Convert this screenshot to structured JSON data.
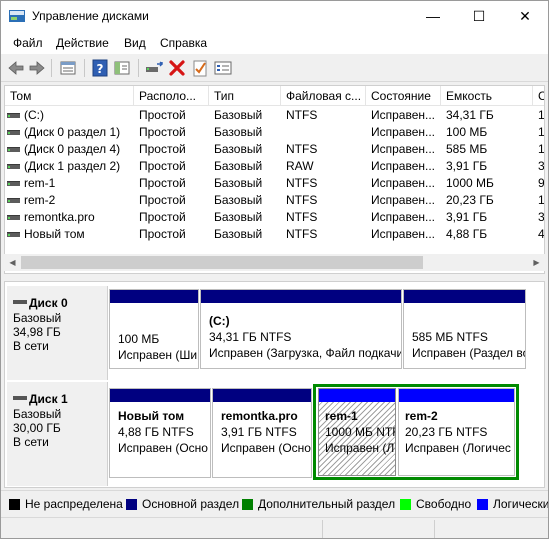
{
  "window": {
    "title": "Управление дисками",
    "controls": {
      "minimize": "—",
      "maximize": "☐",
      "close": "✕"
    }
  },
  "menu": [
    "Файл",
    "Действие",
    "Вид",
    "Справка"
  ],
  "toolbar": {
    "icons": [
      "back-arrow-icon",
      "forward-arrow-icon",
      "properties-list-icon",
      "help-icon",
      "show-hide-pane-icon",
      "connect-disk-icon",
      "delete-icon",
      "check-mark-icon",
      "settings-panel-icon"
    ]
  },
  "volume_list": {
    "columns": [
      "Том",
      "Располо...",
      "Тип",
      "Файловая с...",
      "Состояние",
      "Емкость",
      "С"
    ],
    "rows": [
      {
        "name": "(C:)",
        "layout": "Простой",
        "type": "Базовый",
        "fs": "NTFS",
        "status": "Исправен...",
        "capacity": "34,31 ГБ",
        "free": "1"
      },
      {
        "name": "(Диск 0 раздел 1)",
        "layout": "Простой",
        "type": "Базовый",
        "fs": "",
        "status": "Исправен...",
        "capacity": "100 МБ",
        "free": "1"
      },
      {
        "name": "(Диск 0 раздел 4)",
        "layout": "Простой",
        "type": "Базовый",
        "fs": "NTFS",
        "status": "Исправен...",
        "capacity": "585 МБ",
        "free": "1"
      },
      {
        "name": "(Диск 1 раздел 2)",
        "layout": "Простой",
        "type": "Базовый",
        "fs": "RAW",
        "status": "Исправен...",
        "capacity": "3,91 ГБ",
        "free": "3"
      },
      {
        "name": "rem-1",
        "layout": "Простой",
        "type": "Базовый",
        "fs": "NTFS",
        "status": "Исправен...",
        "capacity": "1000 МБ",
        "free": "9"
      },
      {
        "name": "rem-2",
        "layout": "Простой",
        "type": "Базовый",
        "fs": "NTFS",
        "status": "Исправен...",
        "capacity": "20,23 ГБ",
        "free": "1"
      },
      {
        "name": "remontka.pro",
        "layout": "Простой",
        "type": "Базовый",
        "fs": "NTFS",
        "status": "Исправен...",
        "capacity": "3,91 ГБ",
        "free": "3"
      },
      {
        "name": "Новый том",
        "layout": "Простой",
        "type": "Базовый",
        "fs": "NTFS",
        "status": "Исправен...",
        "capacity": "4,88 ГБ",
        "free": "4"
      }
    ]
  },
  "disks": [
    {
      "name": "Диск 0",
      "type": "Базовый",
      "size": "34,98 ГБ",
      "status": "В сети",
      "partitions": [
        {
          "name": "",
          "size": "100 МБ",
          "status": "Исправен (Ши"
        },
        {
          "name": "(C:)",
          "size": "34,31 ГБ NTFS",
          "status": "Исправен (Загрузка, Файл подкачи"
        },
        {
          "name": "",
          "size": "585 МБ NTFS",
          "status": "Исправен (Раздел во"
        }
      ]
    },
    {
      "name": "Диск 1",
      "type": "Базовый",
      "size": "30,00 ГБ",
      "status": "В сети",
      "partitions": [
        {
          "name": "Новый том",
          "size": "4,88 ГБ NTFS",
          "status": "Исправен (Осно"
        },
        {
          "name": "remontka.pro",
          "size": "3,91 ГБ NTFS",
          "status": "Исправен (Осно"
        },
        {
          "name": "rem-1",
          "size": "1000 МБ NTFS",
          "status": "Исправен (Л"
        },
        {
          "name": "rem-2",
          "size": "20,23 ГБ NTFS",
          "status": "Исправен (Логичес"
        }
      ]
    }
  ],
  "legend": [
    {
      "label": "Не распределена",
      "color": "#000000"
    },
    {
      "label": "Основной раздел",
      "color": "#000080"
    },
    {
      "label": "Дополнительный раздел",
      "color": "#008000"
    },
    {
      "label": "Свободно",
      "color": "#00ff00"
    },
    {
      "label": "Логически",
      "color": "#0000ff"
    }
  ],
  "colors": {
    "primary": "#000080",
    "logical": "#0000ff",
    "extended": "#008a00"
  }
}
